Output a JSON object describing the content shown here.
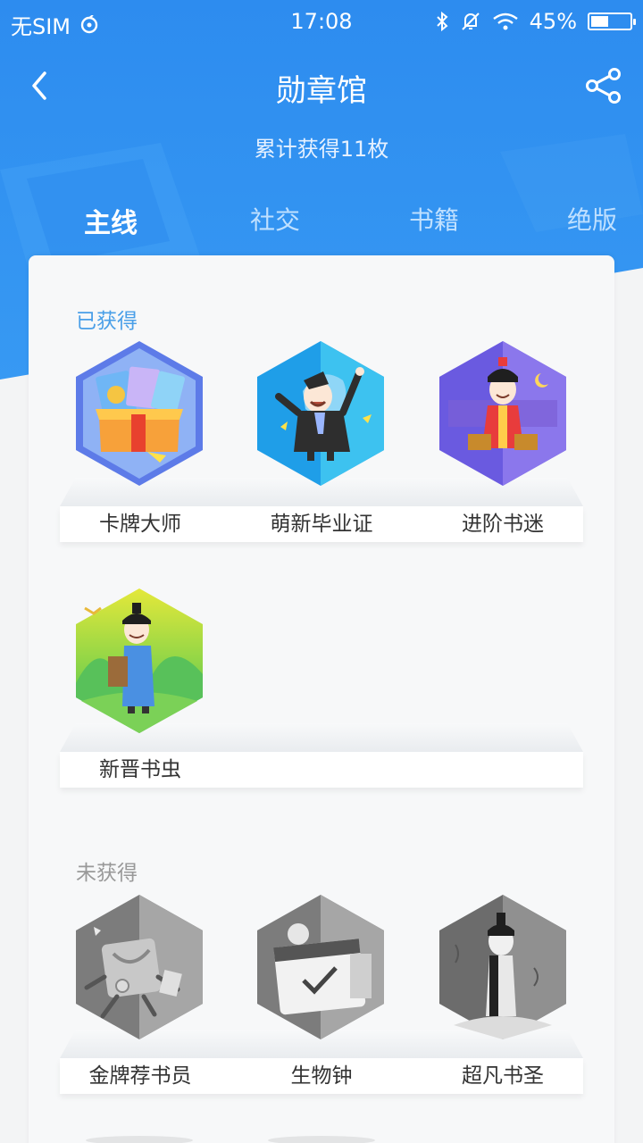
{
  "status_bar": {
    "carrier": "无SIM",
    "time": "17:08",
    "battery": "45%",
    "battery_level": 0.45
  },
  "header": {
    "title": "勋章馆",
    "subtitle": "累计获得11枚"
  },
  "tabs": [
    {
      "label": "主线",
      "active": true
    },
    {
      "label": "社交",
      "active": false
    },
    {
      "label": "书籍",
      "active": false
    },
    {
      "label": "绝版",
      "active": false
    }
  ],
  "obtained": {
    "label": "已获得",
    "badges": [
      {
        "name": "卡牌大师"
      },
      {
        "name": "萌新毕业证"
      },
      {
        "name": "进阶书迷"
      },
      {
        "name": "新晋书虫"
      }
    ]
  },
  "not_obtained": {
    "label": "未获得",
    "badges": [
      {
        "name": "金牌荐书员"
      },
      {
        "name": "生物钟"
      },
      {
        "name": "超凡书圣"
      }
    ]
  },
  "colors": {
    "primary": "#2f8ff0",
    "section_obtained": "#4a9fe8",
    "section_not_obtained": "#999999"
  }
}
